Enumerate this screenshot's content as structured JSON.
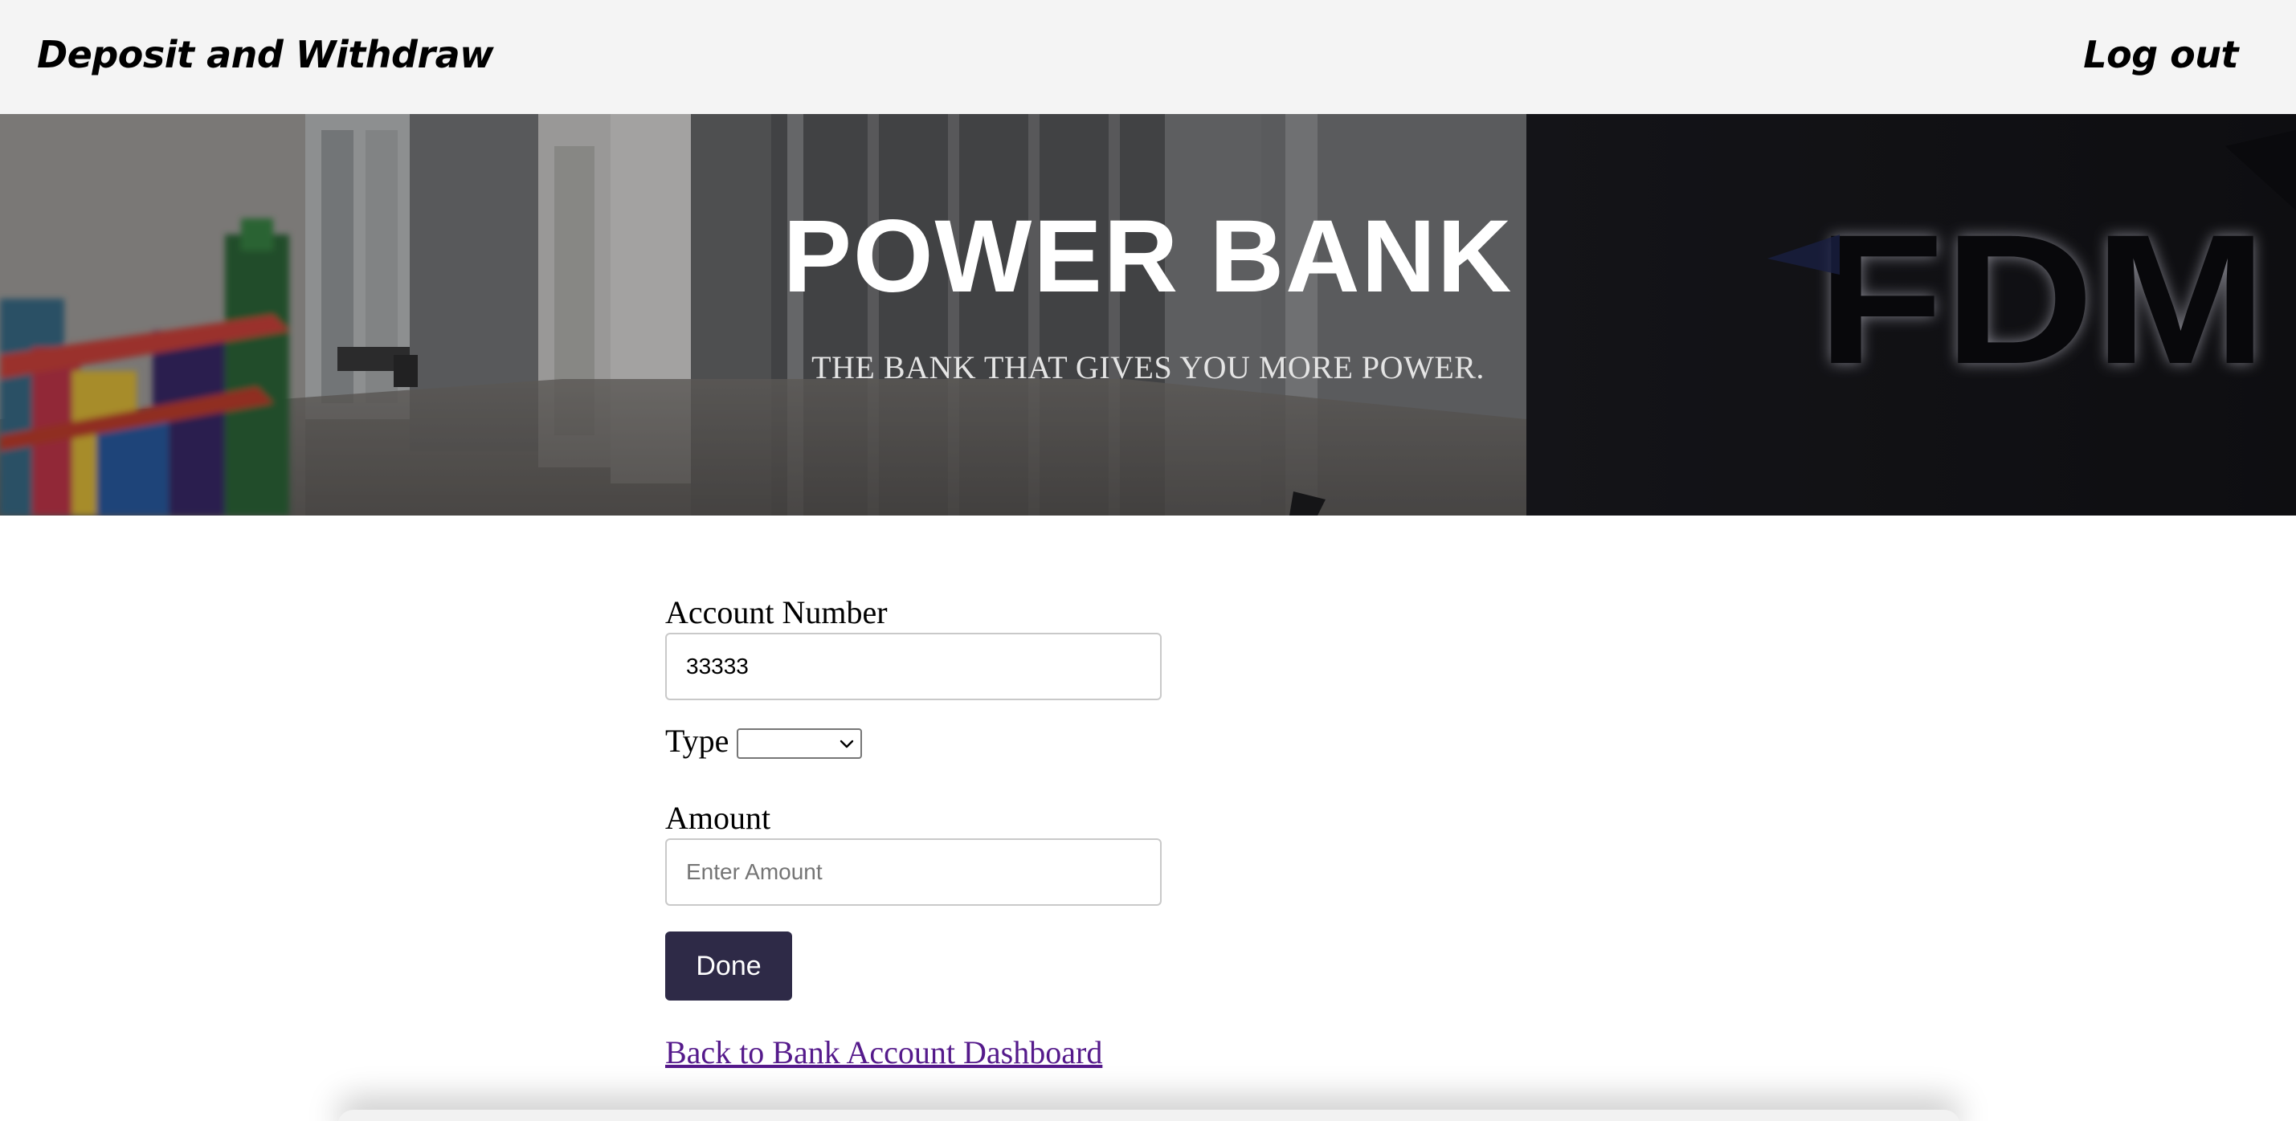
{
  "nav": {
    "title": "Deposit and Withdraw",
    "logout_label": "Log out"
  },
  "hero": {
    "title": "POWER BANK",
    "subtitle": "THE BANK THAT GIVES YOU MORE POWER.",
    "logo_text": "FDM"
  },
  "form": {
    "account_number_label": "Account Number",
    "account_number_value": "33333",
    "type_label": "Type",
    "type_selected": "",
    "amount_label": "Amount",
    "amount_value": "",
    "amount_placeholder": "Enter Amount",
    "submit_label": "Done"
  },
  "links": {
    "back_label": "Back to Bank Account Dashboard"
  },
  "colors": {
    "nav_bg": "#f4f4f4",
    "button_bg": "#2e2a47",
    "link_visited": "#551a8b"
  }
}
